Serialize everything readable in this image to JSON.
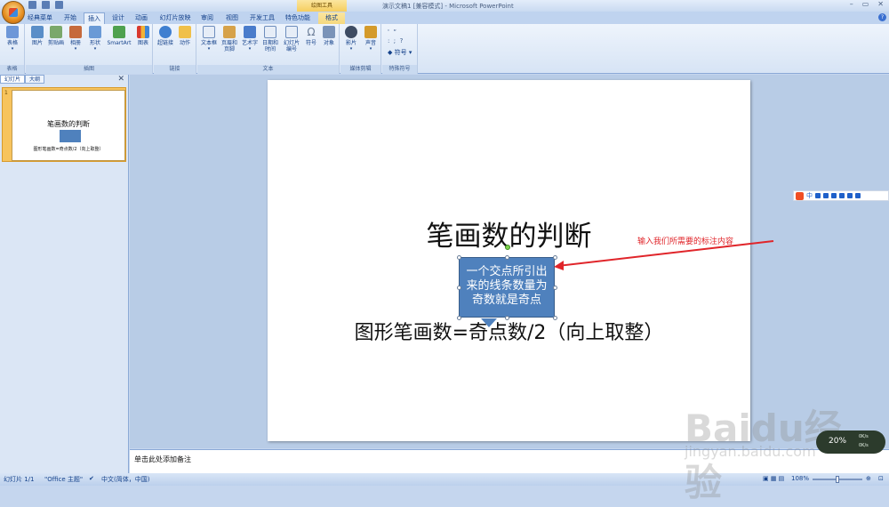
{
  "window": {
    "title": "演示文稿1 [兼容模式] - Microsoft PowerPoint",
    "context_tool": "绘图工具"
  },
  "tabs": [
    "经典菜单",
    "开始",
    "插入",
    "设计",
    "动画",
    "幻灯片放映",
    "审阅",
    "视图",
    "开发工具",
    "特色功能",
    "格式"
  ],
  "active_tab": "插入",
  "ribbon": {
    "groups": [
      {
        "label": "表格",
        "buttons": [
          "表格"
        ]
      },
      {
        "label": "插图",
        "buttons": [
          "图片",
          "剪贴画",
          "相册",
          "形状",
          "SmartArt",
          "图表"
        ]
      },
      {
        "label": "链接",
        "buttons": [
          "超链接",
          "动作"
        ]
      },
      {
        "label": "文本",
        "buttons": [
          "文本框",
          "页眉和页脚",
          "艺术字",
          "日期和时间",
          "幻灯片编号",
          "符号",
          "对象"
        ]
      },
      {
        "label": "媒体剪辑",
        "buttons": [
          "影片",
          "声音"
        ]
      },
      {
        "label": "特殊符号",
        "buttons": [
          "符号"
        ]
      }
    ]
  },
  "panel": {
    "tabs": [
      "幻灯片",
      "大纲"
    ],
    "thumb_number": "1",
    "thumb_title": "笔画数的判断",
    "thumb_sub": "图形笔画数=奇点数/2（向上取整）"
  },
  "slide": {
    "title": "笔画数的判断",
    "callout": "一个交点所引出来的线条数量为奇数就是奇点",
    "subtitle": "图形笔画数=奇点数/2（向上取整）",
    "annotation": "输入我们所需要的标注内容"
  },
  "notes_placeholder": "单击此处添加备注",
  "status": {
    "slide_info": "幻灯片 1/1",
    "theme": "\"Office 主题\"",
    "language": "中文(简体，中国)",
    "zoom": "108%"
  },
  "overlay": {
    "ime_lang": "中",
    "net_percent": "20%",
    "net_up": "0K/s",
    "net_down": "0K/s",
    "watermark": "Baidu经验",
    "watermark_url": "jingyan.baidu.com"
  },
  "colors": {
    "callout_fill": "#4f81bd",
    "annotation": "#e0252a",
    "thumb_selected": "#f7c45e"
  }
}
